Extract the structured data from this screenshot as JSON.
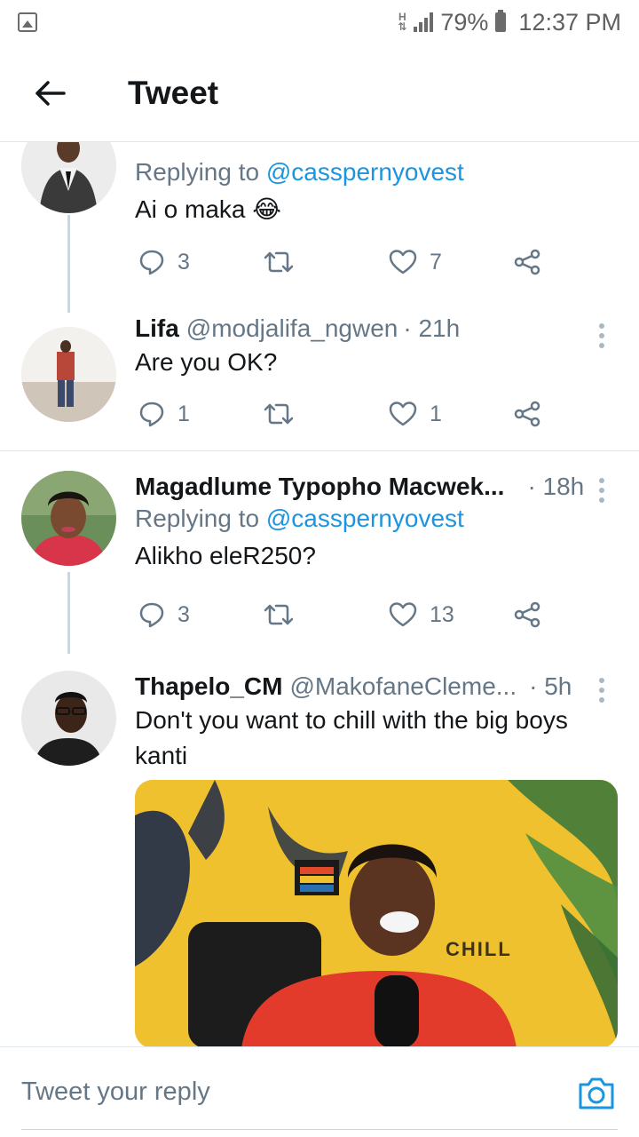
{
  "status_bar": {
    "network": "H",
    "battery": "79%",
    "time": "12:37 PM"
  },
  "header": {
    "title": "Tweet"
  },
  "tweets": [
    {
      "name": "",
      "handle": "",
      "time": "",
      "replying_prefix": "Replying to ",
      "replying_to": "@casspernyovest",
      "text": "Ai o maka 😂",
      "replies": "3",
      "retweets": "",
      "likes": "7"
    },
    {
      "name": "Lifa",
      "handle": "@modjalifa_ngwen",
      "time": "· 21h",
      "text": "Are you OK?",
      "replies": "1",
      "retweets": "",
      "likes": "1"
    },
    {
      "name": "Magadlume Typopho Macwek...",
      "handle": "",
      "time": "· 18h",
      "replying_prefix": "Replying to ",
      "replying_to": "@casspernyovest",
      "text": "Alikho eleR250?",
      "replies": "3",
      "retweets": "",
      "likes": "13"
    },
    {
      "name": "Thapelo_CM",
      "handle": "@MakofaneCleme...",
      "time": "· 5h",
      "text": "Don't you want to chill with the big boys kanti",
      "media_text": "CHILL"
    }
  ],
  "reply_bar": {
    "placeholder": "Tweet your reply"
  },
  "colors": {
    "accent": "#1b95e0",
    "secondary_text": "#657786",
    "border": "#e1e8ed"
  },
  "icons": [
    "back-arrow-icon",
    "reply-icon",
    "retweet-icon",
    "like-icon",
    "share-icon",
    "more-icon",
    "camera-icon"
  ]
}
